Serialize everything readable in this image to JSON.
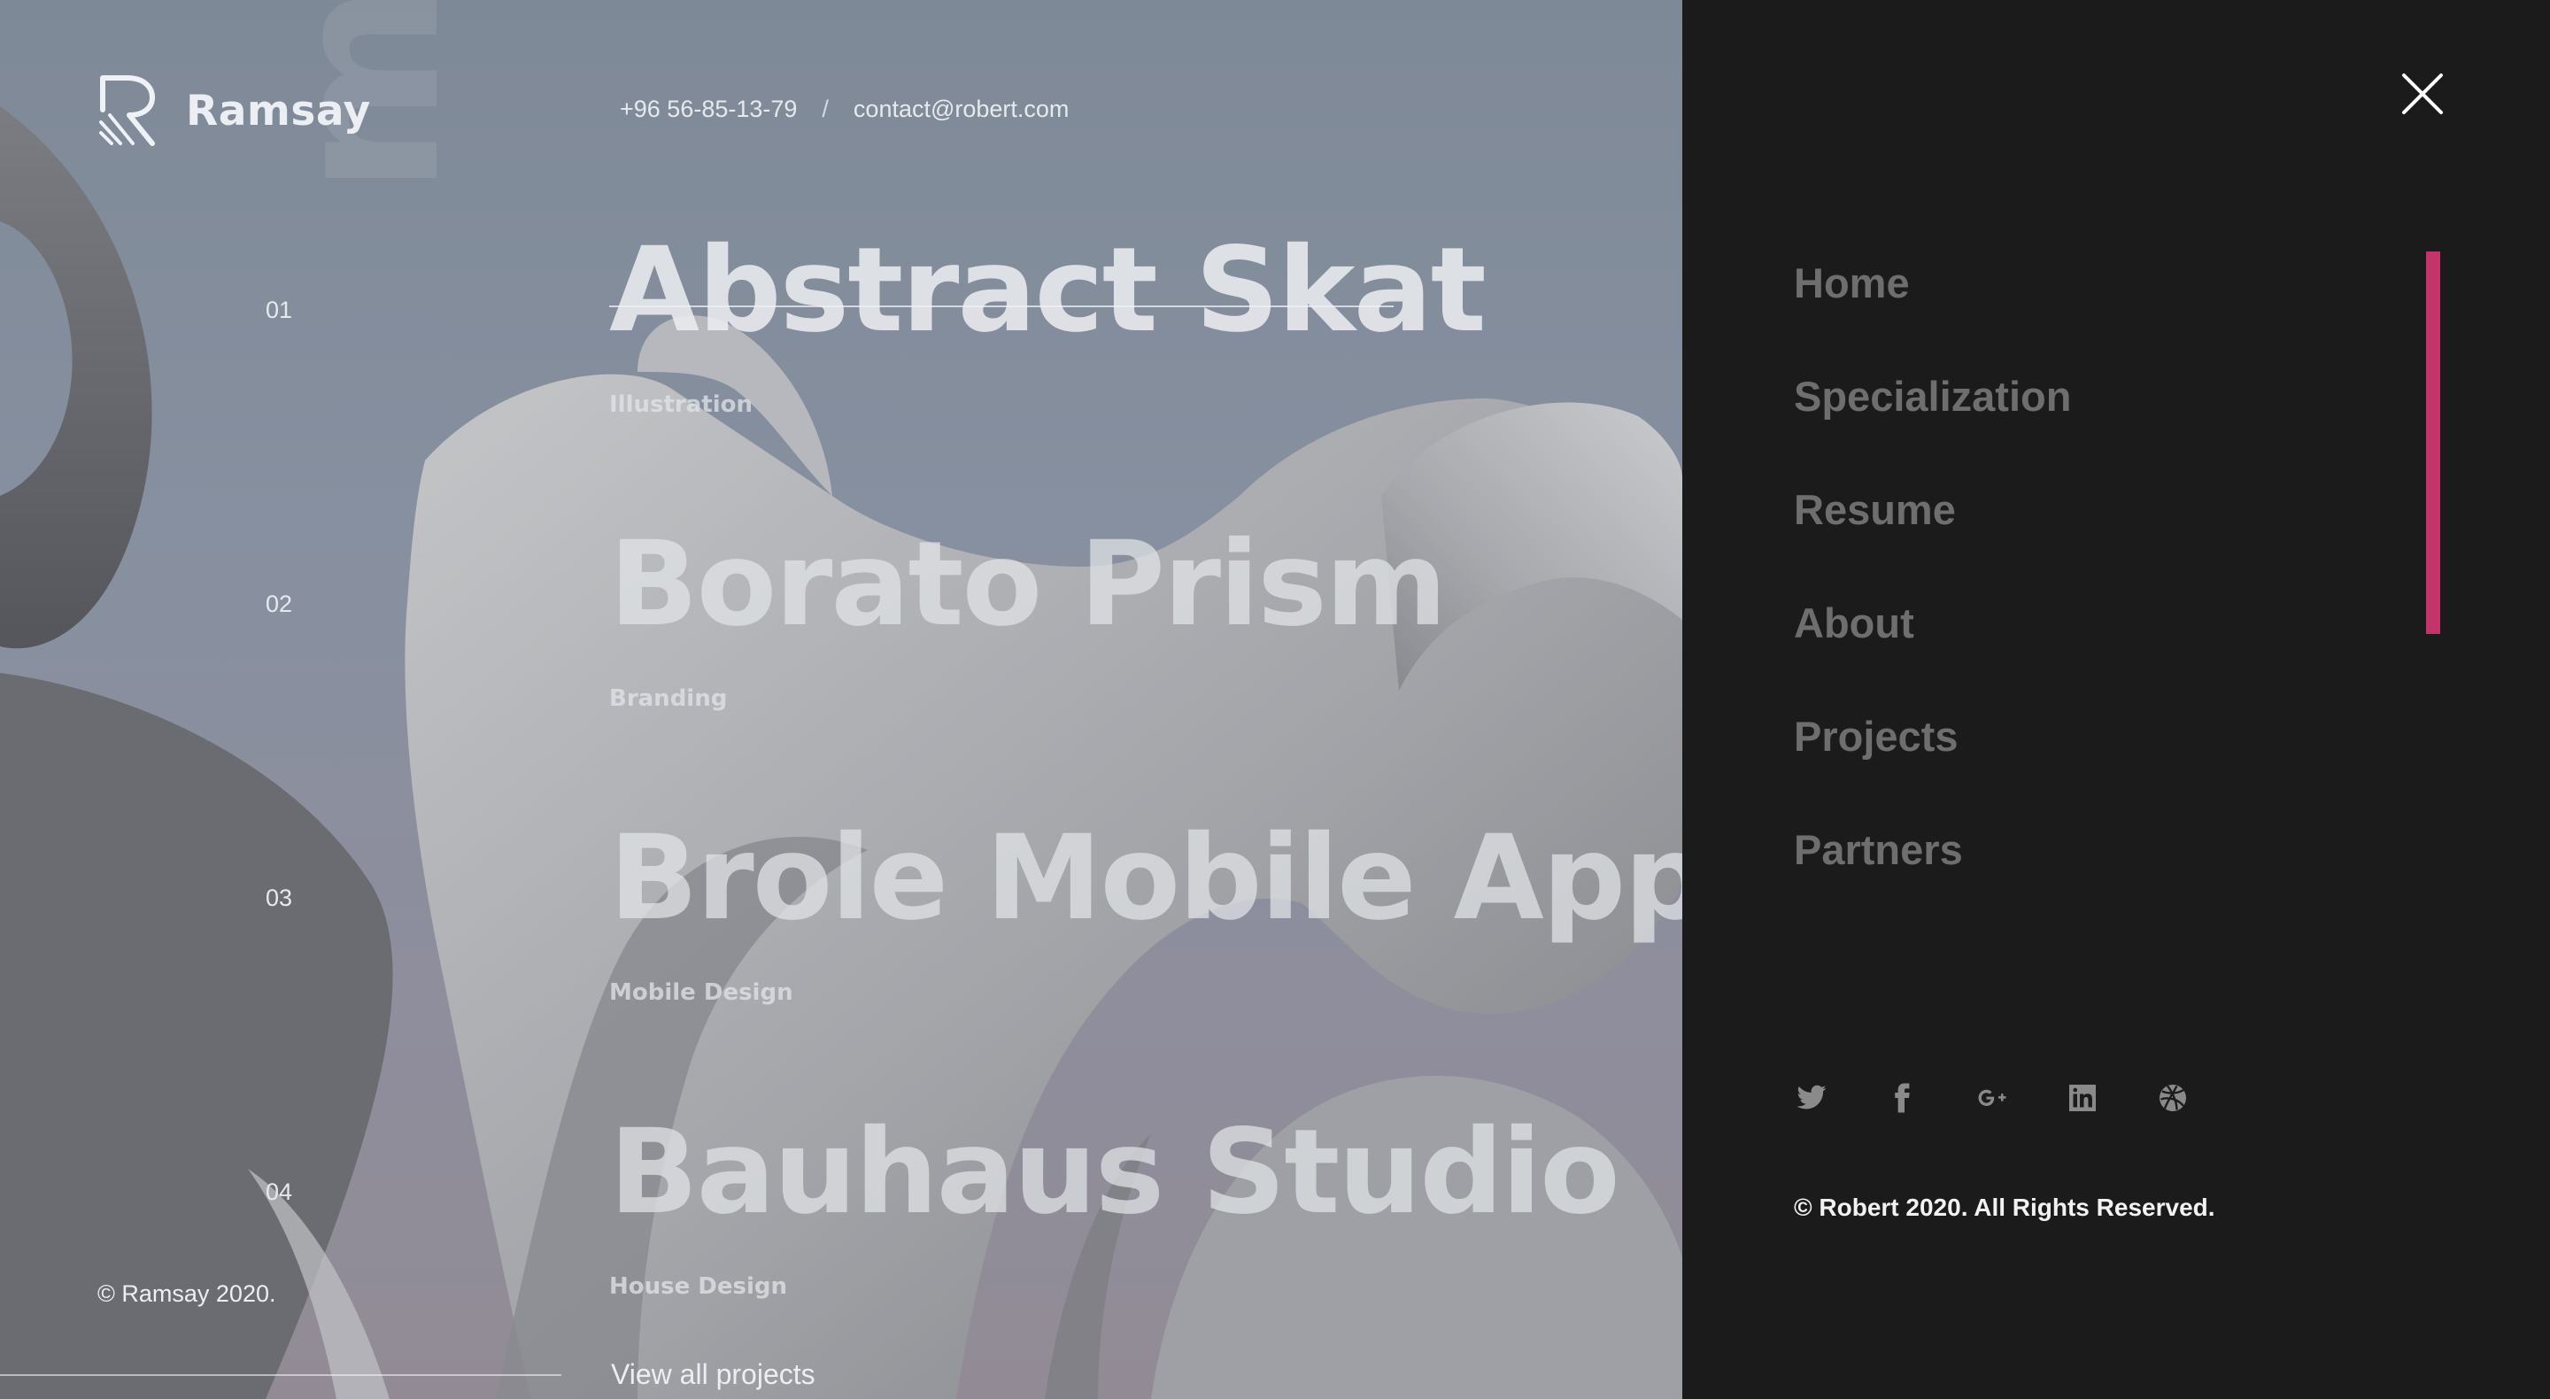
{
  "brand": {
    "name": "Ramsay"
  },
  "contact": {
    "phone": "+96 56-85-13-79",
    "separator": "/",
    "email": "contact@robert.com"
  },
  "hero": {
    "vertical_word": "myWorks"
  },
  "projects": [
    {
      "number": "01",
      "title": "Abstract Skat",
      "category": "Illustration"
    },
    {
      "number": "02",
      "title": "Borato Prism",
      "category": "Branding"
    },
    {
      "number": "03",
      "title": "Brole Mobile App",
      "category": "Mobile Design"
    },
    {
      "number": "04",
      "title": "Bauhaus Studio",
      "category": "House Design"
    }
  ],
  "footer_left": {
    "copyright": "© Ramsay 2020.",
    "view_all": "View all projects"
  },
  "menu": {
    "items": [
      "Home",
      "Specialization",
      "Resume",
      "About",
      "Projects",
      "Partners"
    ],
    "socials": [
      "twitter-icon",
      "facebook-icon",
      "google-plus-icon",
      "linkedin-icon",
      "dribbble-icon"
    ],
    "copyright": "© Robert 2020. All Rights Reserved.",
    "accent_color": "#c2346a",
    "panel_color": "#1b1b1b"
  }
}
